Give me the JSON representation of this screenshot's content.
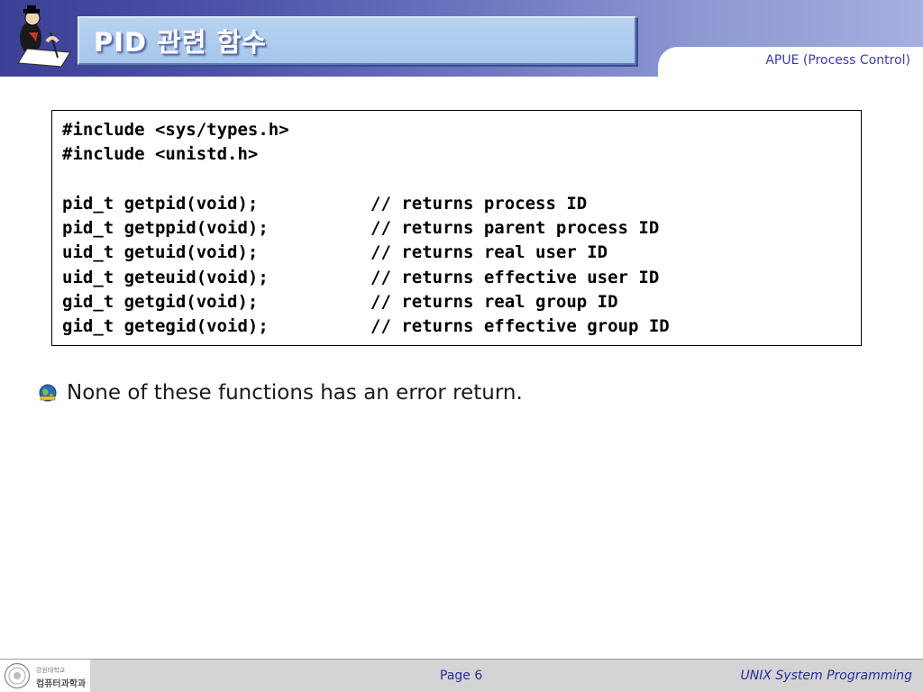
{
  "header": {
    "title": "PID 관련 함수",
    "subtitle": "APUE (Process Control)",
    "logo_icon": "writer-figure-icon"
  },
  "code": {
    "includes": [
      "#include <sys/types.h>",
      "#include <unistd.h>"
    ],
    "functions": [
      {
        "decl": "pid_t getpid(void);",
        "comment": "// returns process ID"
      },
      {
        "decl": "pid_t getppid(void);",
        "comment": "// returns parent process ID"
      },
      {
        "decl": "uid_t getuid(void);",
        "comment": "// returns real user ID"
      },
      {
        "decl": "uid_t geteuid(void);",
        "comment": "// returns effective user ID"
      },
      {
        "decl": "gid_t getgid(void);",
        "comment": "// returns real group ID"
      },
      {
        "decl": "gid_t getegid(void);",
        "comment": "// returns effective group ID"
      }
    ]
  },
  "bullet": {
    "icon": "bullet-globe-icon",
    "text": "None of these functions has an error return."
  },
  "footer": {
    "org_top": "강원대학교",
    "org_bottom": "컴퓨터과학과",
    "page": "Page 6",
    "course": "UNIX System Programming"
  },
  "colors": {
    "header_dark": "#3c3f96",
    "header_light": "#a5afe0",
    "title_bar": "#a6c6ec",
    "accent_text": "#2a2a9a"
  }
}
